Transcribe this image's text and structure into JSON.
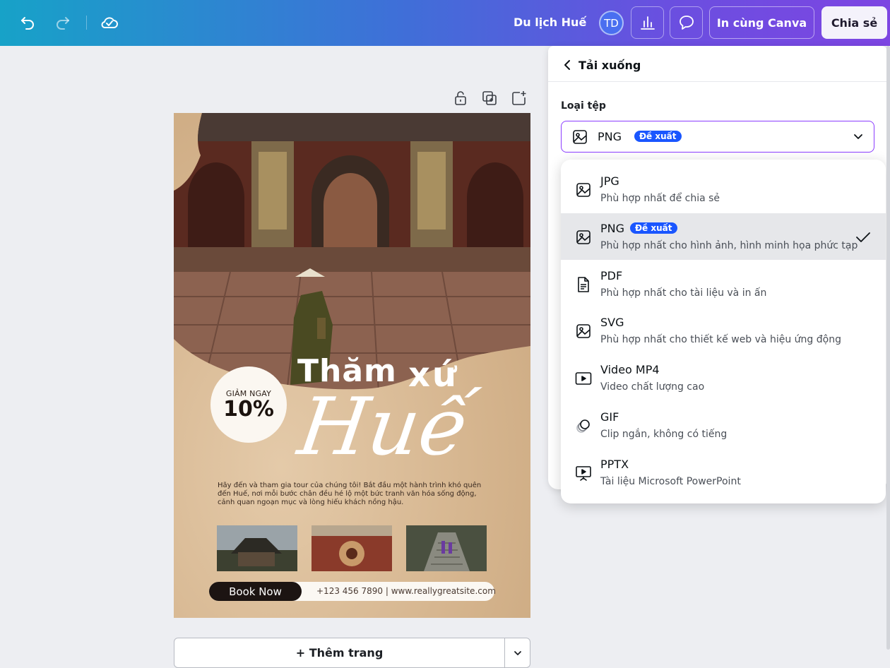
{
  "topbar": {
    "doc_title": "Du lịch Huế",
    "avatar_initials": "TD",
    "print_label": "In cùng Canva",
    "share_label": "Chia sẻ"
  },
  "poster": {
    "badge_top": "GIẢM NGAY",
    "badge_value": "10%",
    "title_1": "Thăm",
    "title_2": "xứ",
    "title_3": "Huế",
    "blurb": "Hãy đến và tham gia tour của chúng tôi! Bắt đầu một hành trình khó quên đến Huế, nơi mỗi bước chân đều hé lộ một bức tranh văn hóa sống động, cảnh quan ngoạn mục và lòng hiếu khách nồng hậu.",
    "book_label": "Book Now",
    "contact": "+123 456 7890 | www.reallygreatsite.com"
  },
  "add_page": {
    "label": "+ Thêm trang"
  },
  "download": {
    "title": "Tải xuống",
    "file_type_label": "Loại tệp",
    "selected": "PNG",
    "recommended": "Đề xuất",
    "options": [
      {
        "name": "JPG",
        "desc": "Phù hợp nhất để chia sẻ"
      },
      {
        "name": "PNG",
        "desc": "Phù hợp nhất cho hình ảnh, hình minh họa phức tạp",
        "badge": "Đề xuất"
      },
      {
        "name": "PDF",
        "desc": "Phù hợp nhất cho tài liệu và in ấn"
      },
      {
        "name": "SVG",
        "desc": "Phù hợp nhất cho thiết kế web và hiệu ứng động"
      },
      {
        "name": "Video MP4",
        "desc": "Video chất lượng cao"
      },
      {
        "name": "GIF",
        "desc": "Clip ngắn, không có tiếng"
      },
      {
        "name": "PPTX",
        "desc": "Tài liệu Microsoft PowerPoint"
      }
    ]
  },
  "colors": {
    "accent": "#8b3dff",
    "badge_blue": "#1a56ff",
    "topbar_start": "#17a2c8",
    "topbar_end": "#7d45e2"
  }
}
